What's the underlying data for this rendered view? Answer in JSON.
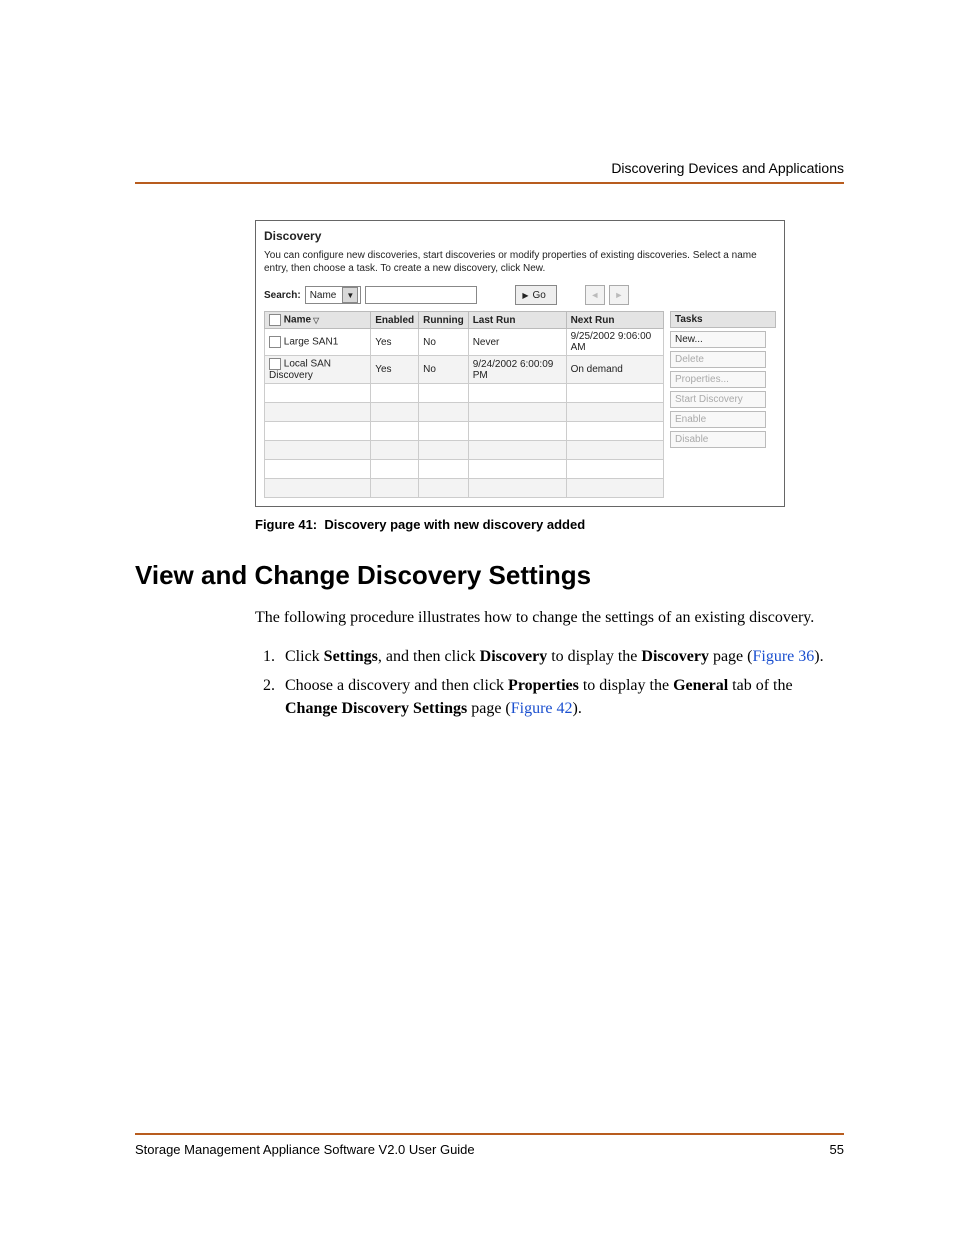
{
  "header": {
    "running_title": "Discovering Devices and Applications"
  },
  "screenshot": {
    "title": "Discovery",
    "description": "You can configure new discoveries, start discoveries or modify properties of existing discoveries. Select a name entry, then choose a task. To create a new discovery, click New.",
    "search": {
      "label": "Search:",
      "select_value": "Name",
      "go_label": "Go"
    },
    "columns": {
      "name": "Name",
      "enabled": "Enabled",
      "running": "Running",
      "last_run": "Last Run",
      "next_run": "Next Run"
    },
    "tasks_header": "Tasks",
    "rows": [
      {
        "name": "Large SAN1",
        "enabled": "Yes",
        "running": "No",
        "last_run": "Never",
        "next_run": "9/25/2002 9:06:00 AM"
      },
      {
        "name": "Local SAN Discovery",
        "enabled": "Yes",
        "running": "No",
        "last_run": "9/24/2002 6:00:09 PM",
        "next_run": "On demand"
      }
    ],
    "tasks": {
      "new": "New...",
      "delete": "Delete",
      "properties": "Properties...",
      "start": "Start Discovery",
      "enable": "Enable",
      "disable": "Disable"
    }
  },
  "caption": {
    "prefix": "Figure 41:",
    "text": "Discovery page with new discovery added"
  },
  "section": {
    "heading": "View and Change Discovery Settings"
  },
  "intro": "The following procedure illustrates how to change the settings of an existing discovery.",
  "steps": {
    "s1_a": "Click ",
    "s1_b": "Settings",
    "s1_c": ", and then click ",
    "s1_d": "Discovery",
    "s1_e": " to display the ",
    "s1_f": "Discovery",
    "s1_g": " page (",
    "s1_h": "Figure 36",
    "s1_i": ").",
    "s2_a": "Choose a discovery and then click ",
    "s2_b": "Properties",
    "s2_c": " to display the ",
    "s2_d": "General",
    "s2_e": " tab of the ",
    "s2_f": "Change Discovery Settings",
    "s2_g": " page (",
    "s2_h": "Figure 42",
    "s2_i": ")."
  },
  "footer": {
    "left": "Storage Management Appliance Software V2.0 User Guide",
    "page": "55"
  }
}
